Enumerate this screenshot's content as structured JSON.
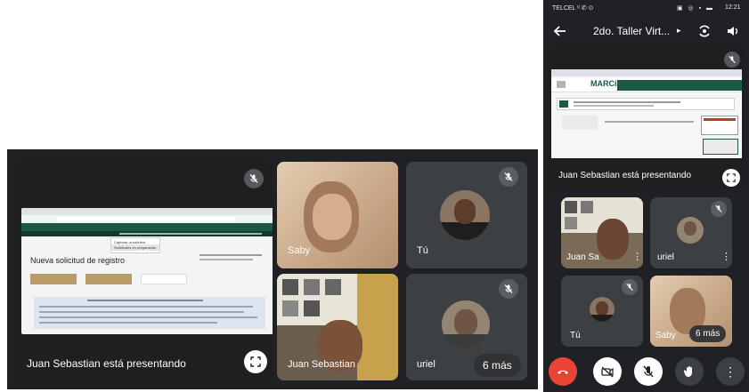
{
  "desktop": {
    "presenter_label": "Juan Sebastian está presentando",
    "participants": [
      {
        "name": "Saby"
      },
      {
        "name": "Tú"
      },
      {
        "name": "Juan Sebastian"
      },
      {
        "name": "uriel"
      }
    ],
    "more_label": "6 más",
    "shared_screen": {
      "page_heading": "Nueva solicitud de registro",
      "menu_item_1": "Capturar la solicitud",
      "menu_item_2": "Solicitudes en preparación"
    }
  },
  "phone": {
    "status_left": "TELCEL ᵗˡ ✆ ⊙",
    "status_time": "12:21",
    "meeting_title": "2do. Taller Virt...",
    "presenter_label": "Juan Sebastian está presentando",
    "shared_logo": "MARCia",
    "participants": [
      {
        "name": "Juan Sa"
      },
      {
        "name": "uriel"
      },
      {
        "name": "Tú"
      },
      {
        "name": "Saby"
      }
    ],
    "more_label": "6 más"
  },
  "colors": {
    "meet_bg": "#202124",
    "tile_bg": "#3c4043",
    "end_call": "#ea4335",
    "marc_green": "#1c5a46"
  }
}
